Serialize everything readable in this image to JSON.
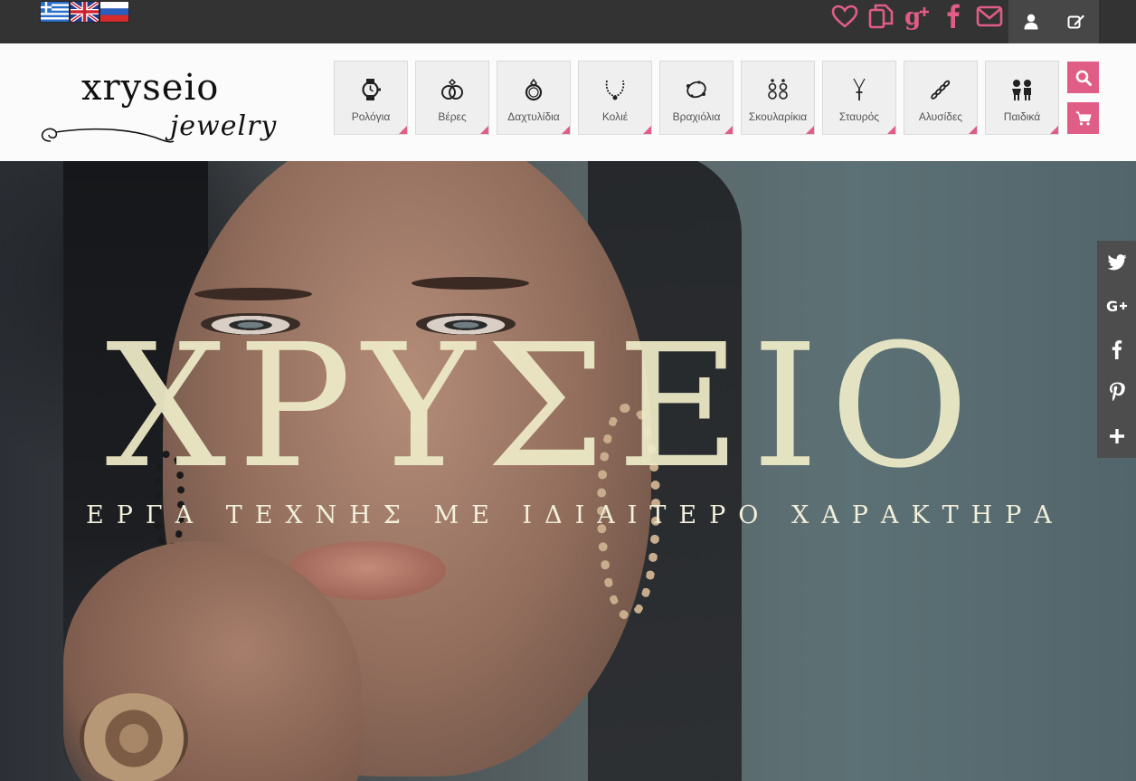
{
  "topbar": {
    "languages": [
      {
        "name": "greek-flag",
        "label": "Ελληνικά"
      },
      {
        "name": "uk-flag",
        "label": "English"
      },
      {
        "name": "russia-flag",
        "label": "Русский"
      }
    ],
    "social_icons": [
      "heart-icon",
      "compare-icon",
      "google-plus-icon",
      "facebook-icon",
      "envelope-icon"
    ],
    "account_icons": [
      "user-icon",
      "edit-icon"
    ],
    "accent_color": "#e05d86"
  },
  "header": {
    "logo_main": "xryseio",
    "logo_sub": "jewelry",
    "categories": [
      {
        "label": "Ρολόγια",
        "icon": "watch-icon"
      },
      {
        "label": "Βέρες",
        "icon": "wedding-rings-icon"
      },
      {
        "label": "Δαχτυλίδια",
        "icon": "ring-icon"
      },
      {
        "label": "Κολιέ",
        "icon": "necklace-icon"
      },
      {
        "label": "Βραχιόλια",
        "icon": "bracelet-icon"
      },
      {
        "label": "Σκουλαρίκια",
        "icon": "earrings-icon"
      },
      {
        "label": "Σταυρός",
        "icon": "cross-pendant-icon"
      },
      {
        "label": "Αλυσίδες",
        "icon": "chain-icon"
      },
      {
        "label": "Παιδικά",
        "icon": "kids-icon"
      }
    ],
    "search_icon": "search-icon",
    "cart_icon": "cart-icon"
  },
  "hero": {
    "title": "ΧΡΥΣΕΙΟ",
    "subtitle": "ΕΡΓΑ ΤΕΧΝΗΣ ΜΕ ΙΔΙΑΙΤΕΡΟ ΧΑΡΑΚΤΗΡΑ"
  },
  "share_bar": [
    "twitter-icon",
    "google-plus-icon",
    "facebook-icon",
    "pinterest-icon",
    "plus-icon"
  ]
}
